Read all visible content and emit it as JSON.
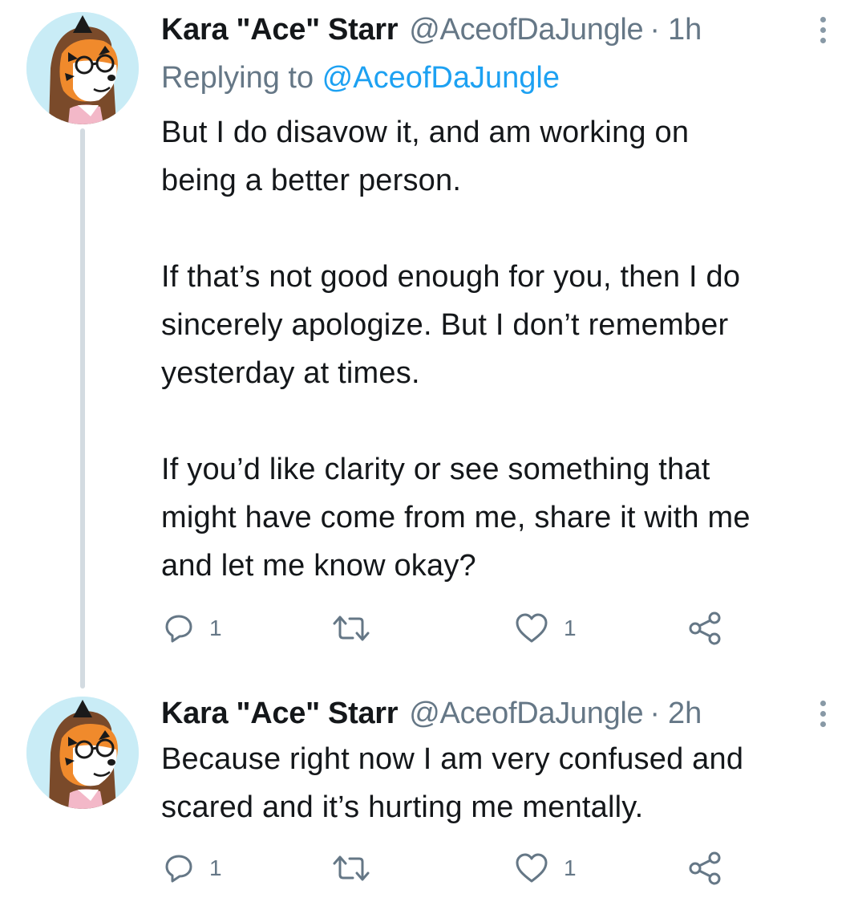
{
  "tweets": [
    {
      "author": {
        "display_name": "Kara \"Ace\" Starr",
        "handle": "@AceofDaJungle"
      },
      "separator": "·",
      "time": "1h",
      "replying_prefix": "Replying to ",
      "replying_to": "@AceofDaJungle",
      "paragraphs": [
        "But I do disavow it, and am working on\nbeing a better person.",
        "If that’s not good enough for you, then I do\nsincerely apologize. But I don’t remember\nyesterday at times.",
        "If you’d like clarity or see something that\nmight have come from me, share it with me\nand let me know okay?"
      ],
      "actions": {
        "reply_count": "1",
        "retweet_count": "",
        "like_count": "1"
      }
    },
    {
      "author": {
        "display_name": "Kara \"Ace\" Starr",
        "handle": "@AceofDaJungle"
      },
      "separator": "·",
      "time": "2h",
      "paragraphs": [
        "Because right now I am very confused and\nscared and it’s hurting me mentally."
      ],
      "actions": {
        "reply_count": "1",
        "retweet_count": "",
        "like_count": "1"
      }
    }
  ],
  "icons": {
    "more": "more-vertical-icon",
    "reply": "reply-icon",
    "retweet": "retweet-icon",
    "like": "heart-icon",
    "share": "share-icon"
  },
  "colors": {
    "text": "#14171a",
    "secondary": "#657786",
    "link": "#1da1f2",
    "icon": "#657786",
    "thread_line": "#d3dbe1"
  }
}
